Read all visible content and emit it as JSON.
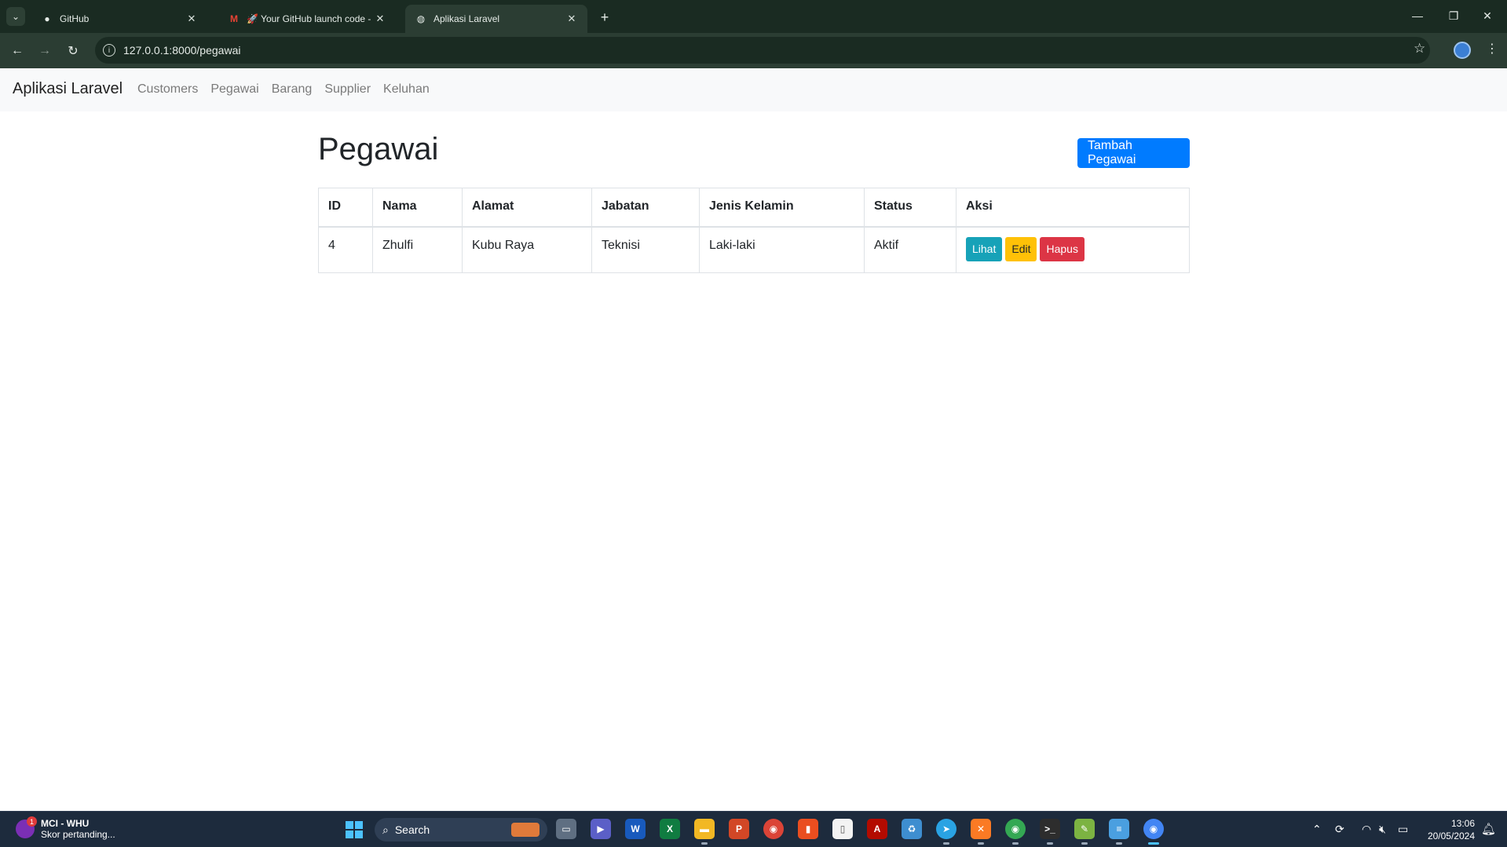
{
  "browser": {
    "tabs": [
      {
        "title": "GitHub",
        "icon": "github-icon",
        "active": false
      },
      {
        "title": "🚀 Your GitHub launch code - ",
        "icon": "gmail-icon",
        "active": false
      },
      {
        "title": "Aplikasi Laravel",
        "icon": "globe-icon",
        "active": true
      }
    ],
    "url": "127.0.0.1:8000/pegawai"
  },
  "app": {
    "brand": "Aplikasi Laravel",
    "nav": [
      "Customers",
      "Pegawai",
      "Barang",
      "Supplier",
      "Keluhan"
    ]
  },
  "page": {
    "title": "Pegawai",
    "add_button": "Tambah Pegawai",
    "table": {
      "columns": [
        "ID",
        "Nama",
        "Alamat",
        "Jabatan",
        "Jenis Kelamin",
        "Status",
        "Aksi"
      ],
      "rows": [
        {
          "id": "4",
          "nama": "Zhulfi",
          "alamat": "Kubu Raya",
          "jabatan": "Teknisi",
          "jenis_kelamin": "Laki-laki",
          "status": "Aktif"
        }
      ],
      "actions": {
        "view": "Lihat",
        "edit": "Edit",
        "delete": "Hapus"
      }
    }
  },
  "taskbar": {
    "widget_title": "MCI - WHU",
    "widget_subtitle": "Skor pertanding...",
    "widget_badge": "1",
    "search_placeholder": "Search",
    "time": "13:06",
    "date": "20/05/2024"
  },
  "colors": {
    "primary": "#007bff",
    "info": "#17a2b8",
    "warning": "#ffc107",
    "danger": "#dc3545"
  }
}
